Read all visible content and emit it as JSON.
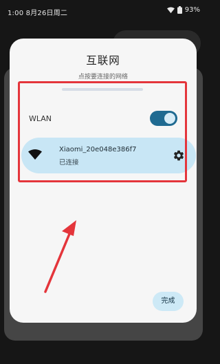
{
  "status_bar": {
    "time_date": "1:00 8月26日周二",
    "battery": "93%",
    "icons": [
      "wifi-icon",
      "battery-icon"
    ]
  },
  "dialog": {
    "title": "互联网",
    "subtitle": "点按要连接的网络",
    "wlan": {
      "label": "WLAN",
      "enabled": true
    },
    "network": {
      "ssid": "Xiaomi_20e048e386f7",
      "status": "已连接",
      "icons": [
        "wifi-signal-icon",
        "gear-icon"
      ]
    },
    "done_button": "完成"
  },
  "annotation": {
    "highlight_color": "#e4353b",
    "arrow_color": "#e4353b"
  },
  "colors": {
    "toggle_on": "#1f6a91",
    "network_bg": "#c8e6f5",
    "done_bg": "#cde9f6"
  }
}
